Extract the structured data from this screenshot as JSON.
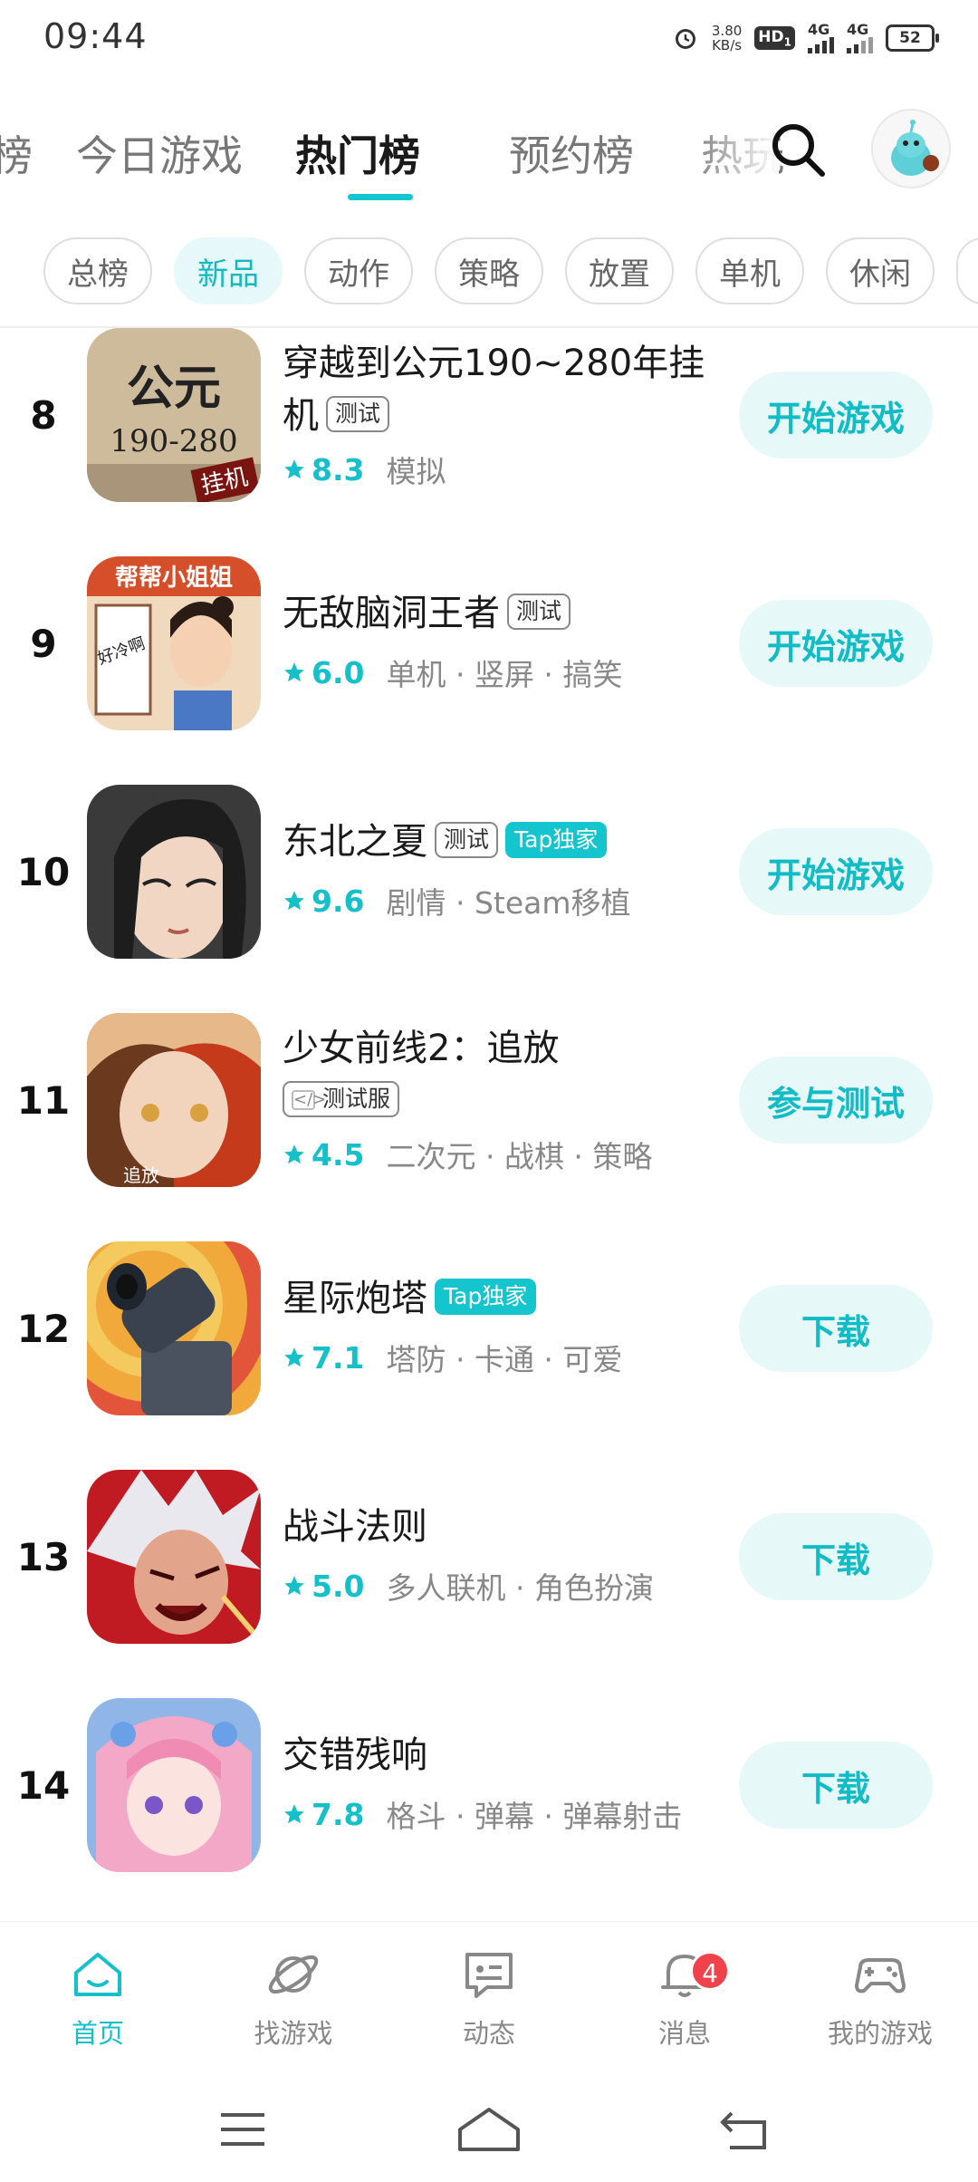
{
  "status_bar": {
    "time": "09:44",
    "speed_value": "3.80",
    "speed_unit": "KB/s",
    "hd": "HD",
    "hd_sub": "1",
    "net1": "4G",
    "net2": "4G",
    "battery": "52"
  },
  "top_tabs": [
    {
      "label": "榜"
    },
    {
      "label": "今日游戏"
    },
    {
      "label": "热门榜"
    },
    {
      "label": "预约榜"
    },
    {
      "label": "热玩"
    }
  ],
  "chips": [
    "总榜",
    "新品",
    "动作",
    "策略",
    "放置",
    "单机",
    "休闲"
  ],
  "games": [
    {
      "rank": "8",
      "title_line1": "穿越到公元190~280年挂",
      "title_line2": "机",
      "tags": [
        "测试"
      ],
      "rating": "8.3",
      "genres": "模拟",
      "button": "开始游戏"
    },
    {
      "rank": "9",
      "title_line1": "无敌脑洞王者",
      "tags": [
        "测试"
      ],
      "rating": "6.0",
      "genres": "单机 · 竖屏 · 搞笑",
      "button": "开始游戏"
    },
    {
      "rank": "10",
      "title_line1": "东北之夏",
      "tags": [
        "测试",
        "Tap独家"
      ],
      "rating": "9.6",
      "genres": "剧情 · Steam移植",
      "button": "开始游戏"
    },
    {
      "rank": "11",
      "title_line1": "少女前线2：追放",
      "tags": [
        "测试服"
      ],
      "rating": "4.5",
      "genres": "二次元 · 战棋 · 策略",
      "button": "参与测试"
    },
    {
      "rank": "12",
      "title_line1": "星际炮塔",
      "tags": [
        "Tap独家"
      ],
      "rating": "7.1",
      "genres": "塔防 · 卡通 · 可爱",
      "button": "下载"
    },
    {
      "rank": "13",
      "title_line1": "战斗法则",
      "tags": [],
      "rating": "5.0",
      "genres": "多人联机 · 角色扮演",
      "button": "下载"
    },
    {
      "rank": "14",
      "title_line1": "交错残响",
      "tags": [],
      "rating": "7.8",
      "genres": "格斗 · 弹幕 · 弹幕射击",
      "button": "下载"
    }
  ],
  "icon_text": {
    "g8_big": "公元",
    "g8_years": "190-280",
    "g8_corner": "挂机",
    "g9_banner": "帮帮小姐姐",
    "g9_note": "好冷啊",
    "g11_logo": "追放"
  },
  "bottom_nav": [
    {
      "label": "首页"
    },
    {
      "label": "找游戏"
    },
    {
      "label": "动态"
    },
    {
      "label": "消息",
      "badge": "4"
    },
    {
      "label": "我的游戏"
    }
  ],
  "colors": {
    "accent": "#15c5ce",
    "badge": "#f0424b"
  }
}
